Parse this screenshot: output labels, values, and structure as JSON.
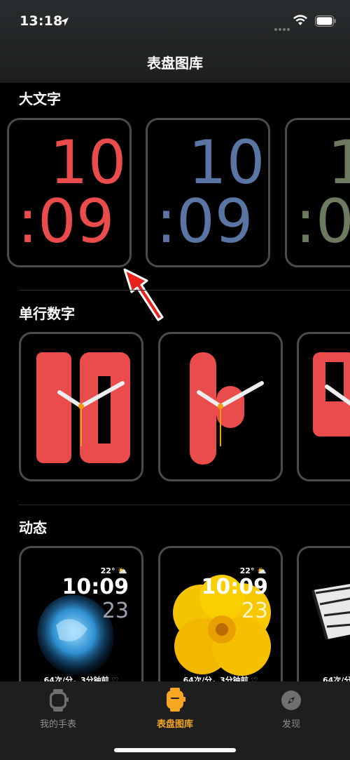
{
  "status_bar": {
    "time": "13:18"
  },
  "nav": {
    "title": "表盘图库"
  },
  "sections": {
    "large_text": {
      "title": "大文字",
      "faces": [
        {
          "hour": "10",
          "minute": ":09",
          "color": "#ea4b4b"
        },
        {
          "hour": "10",
          "minute": ":09",
          "color": "#5a74a3"
        },
        {
          "hour": "1",
          "minute": ":0",
          "color": "#6e7a60"
        }
      ]
    },
    "single_line": {
      "title": "单行数字",
      "accent": "#ea4b4b"
    },
    "dynamic": {
      "title": "动态",
      "faces": [
        {
          "temp": "22°",
          "time": "10:09",
          "date": "23",
          "heart": "64次/分，3分钟前"
        },
        {
          "temp": "22°",
          "time": "10:09",
          "date": "23",
          "heart": "64次/分，3分钟前"
        },
        {
          "heart": "64次/分"
        }
      ]
    }
  },
  "tabs": [
    {
      "label": "我的手表",
      "icon": "watch-icon",
      "active": false
    },
    {
      "label": "表盘图库",
      "icon": "watch-face-icon",
      "active": true
    },
    {
      "label": "发现",
      "icon": "compass-icon",
      "active": false
    }
  ],
  "colors": {
    "active_tab": "#f5a623",
    "inactive_tab": "#8e8e93"
  }
}
